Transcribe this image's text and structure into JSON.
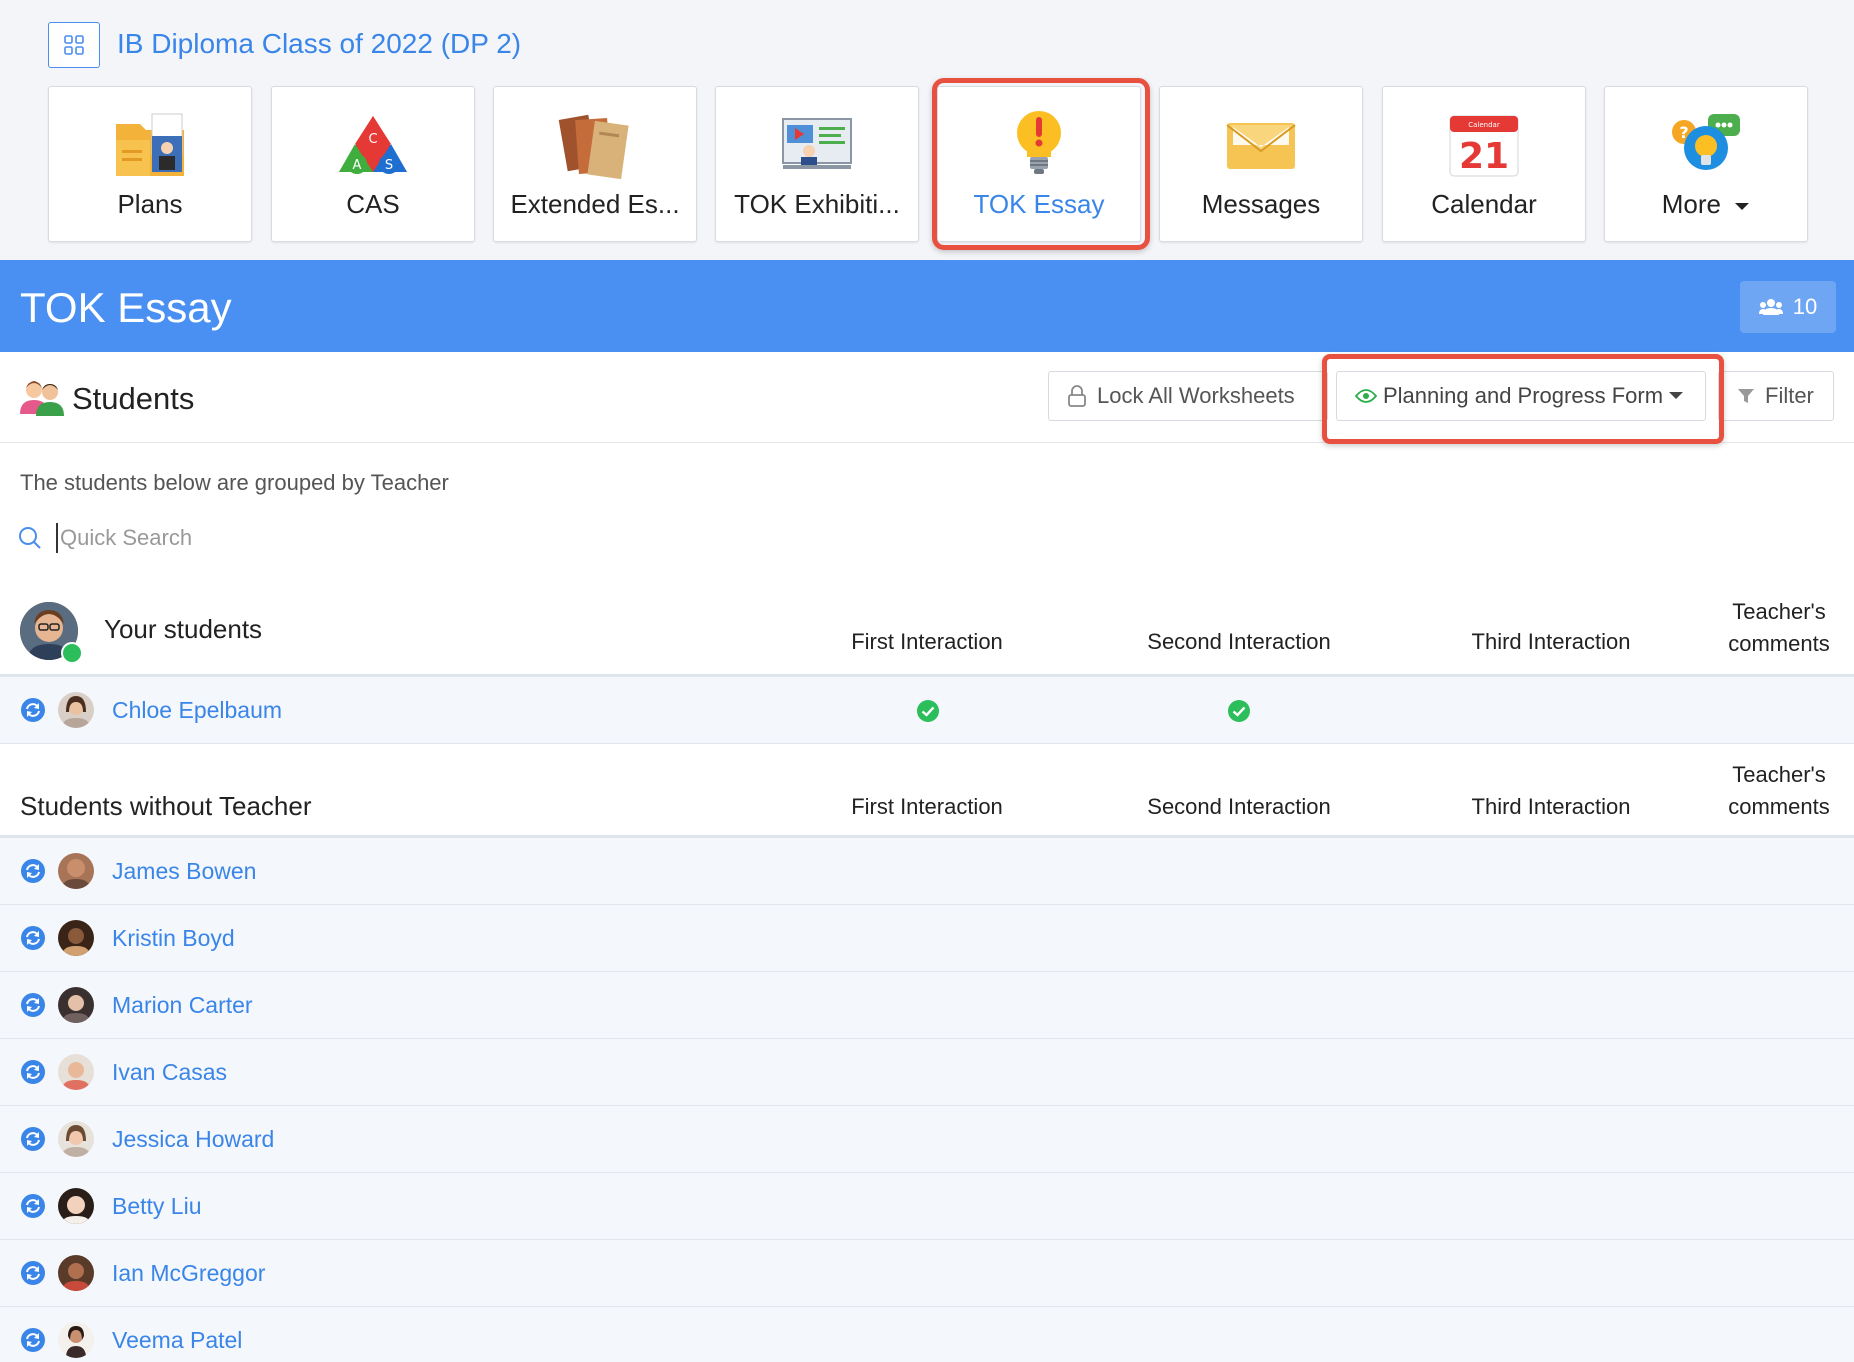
{
  "app": {
    "class_title": "IB Diploma Class of 2022 (DP 2)",
    "tiles": [
      {
        "label": "Plans",
        "icon": "plans-folder-icon"
      },
      {
        "label": "CAS",
        "icon": "cas-triangle-icon"
      },
      {
        "label": "Extended Es...",
        "icon": "books-icon"
      },
      {
        "label": "TOK Exhibiti...",
        "icon": "exhibition-screen-icon"
      },
      {
        "label": "TOK Essay",
        "icon": "lightbulb-icon",
        "active": true
      },
      {
        "label": "Messages",
        "icon": "envelope-icon"
      },
      {
        "label": "Calendar",
        "icon": "calendar-icon",
        "calendar_day": "21",
        "calendar_month": "Calendar"
      },
      {
        "label": "More",
        "icon": "more-icon"
      }
    ]
  },
  "header": {
    "title": "TOK Essay",
    "count": "10"
  },
  "students_section": {
    "title": "Students",
    "lock_button": "Lock All Worksheets",
    "form_select": "Planning and Progress Form",
    "filter_button": "Filter",
    "grouped_note": "The students below are grouped by Teacher",
    "search_placeholder": "Quick Search"
  },
  "columns": {
    "first": "First Interaction",
    "second": "Second Interaction",
    "third": "Third Interaction",
    "comments_line1": "Teacher's",
    "comments_line2": "comments"
  },
  "groups": [
    {
      "title": "Your students",
      "students": [
        {
          "name": "Chloe Epelbaum",
          "first": true,
          "second": true,
          "third": false
        }
      ]
    },
    {
      "title": "Students without Teacher",
      "students": [
        {
          "name": "James Bowen"
        },
        {
          "name": "Kristin Boyd"
        },
        {
          "name": "Marion Carter"
        },
        {
          "name": "Ivan Casas"
        },
        {
          "name": "Jessica Howard"
        },
        {
          "name": "Betty Liu"
        },
        {
          "name": "Ian McGreggor"
        },
        {
          "name": "Veema Patel"
        }
      ]
    }
  ],
  "colors": {
    "accent": "#3a85e8",
    "header": "#4a8ff2",
    "highlight": "#e8503f",
    "check": "#2cbe5a"
  }
}
